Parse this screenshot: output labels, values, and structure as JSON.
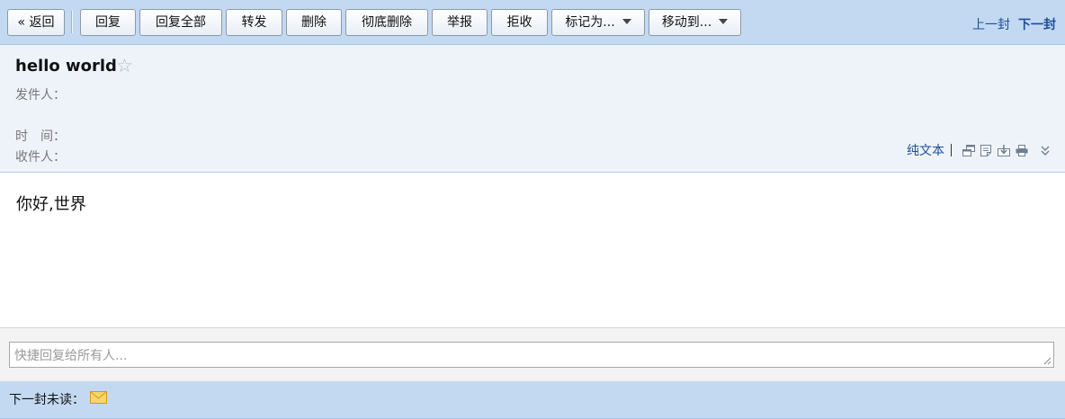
{
  "toolbar": {
    "back_label": "« 返回",
    "reply_label": "回复",
    "reply_all_label": "回复全部",
    "forward_label": "转发",
    "delete_label": "删除",
    "delete_permanent_label": "彻底删除",
    "report_label": "举报",
    "reject_label": "拒收",
    "mark_as_label": "标记为...",
    "move_to_label": "移动到...",
    "prev_label": "上一封",
    "next_label": "下一封"
  },
  "header": {
    "subject": "hello world",
    "star_glyph": "☆",
    "sender_label": "发件人：",
    "time_label": "时　间：",
    "recipient_label": "收件人：",
    "plain_text_label": "纯文本",
    "icons": [
      "new-window-icon",
      "note-icon",
      "download-icon",
      "print-icon",
      "expand-more-icon"
    ]
  },
  "message": {
    "body": "你好,世界"
  },
  "quick_reply": {
    "placeholder": "快捷回复给所有人..."
  },
  "footer": {
    "next_unread_label": "下一封未读：",
    "mail_icon": "envelope-icon"
  },
  "colors": {
    "toolbar_bg": "#c3d9f1",
    "header_bg": "#eef3fa",
    "link": "#1f4e9a",
    "envelope": "#f2c24f"
  }
}
